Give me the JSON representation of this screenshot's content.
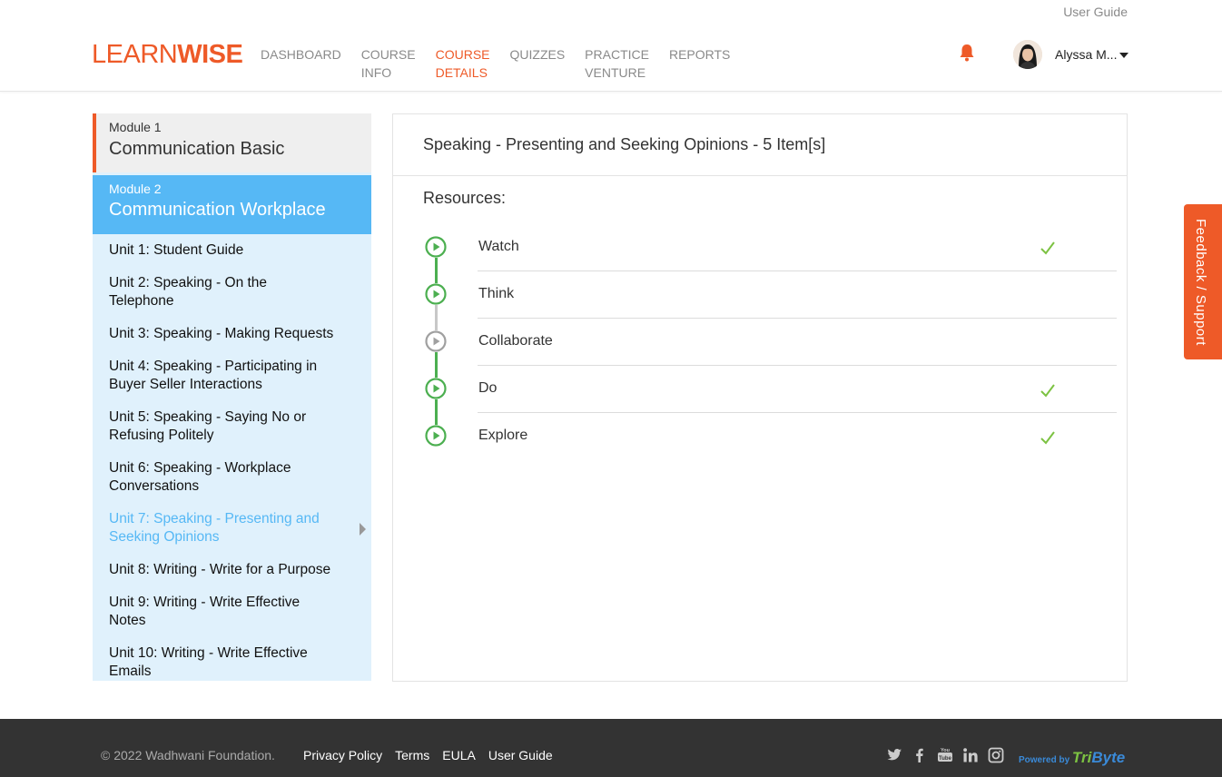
{
  "header": {
    "top_link": "User Guide",
    "logo_learn": "LEARN",
    "logo_wise": "WISE",
    "nav": [
      {
        "line1": "DASHBOARD",
        "line2": ""
      },
      {
        "line1": "COURSE",
        "line2": "INFO"
      },
      {
        "line1": "COURSE",
        "line2": "DETAILS"
      },
      {
        "line1": "QUIZZES",
        "line2": ""
      },
      {
        "line1": "PRACTICE",
        "line2": "VENTURE"
      },
      {
        "line1": "REPORTS",
        "line2": ""
      }
    ],
    "active_nav": "COURSE DETAILS",
    "user_name": "Alyssa M..."
  },
  "sidebar": {
    "module1": {
      "label": "Module 1",
      "title": "Communication Basic"
    },
    "module2": {
      "label": "Module 2",
      "title": "Communication Workplace"
    },
    "units": [
      {
        "line1": "Unit 1: Student Guide",
        "line2": ""
      },
      {
        "line1": "Unit 2: Speaking - On the",
        "line2": "Telephone"
      },
      {
        "line1": "Unit 3: Speaking - Making Requests",
        "line2": ""
      },
      {
        "line1": "Unit 4: Speaking - Participating in",
        "line2": "Buyer Seller Interactions"
      },
      {
        "line1": "Unit 5: Speaking - Saying No or",
        "line2": "Refusing Politely"
      },
      {
        "line1": "Unit 6: Speaking - Workplace",
        "line2": "Conversations"
      },
      {
        "line1": "Unit 7: Speaking - Presenting and",
        "line2": "Seeking Opinions"
      },
      {
        "line1": "Unit 8: Writing - Write for a Purpose",
        "line2": ""
      },
      {
        "line1": "Unit 9: Writing - Write Effective",
        "line2": "Notes"
      },
      {
        "line1": "Unit 10: Writing - Write Effective",
        "line2": "Emails"
      }
    ],
    "active_unit": "Unit 7: Speaking - Presenting and Seeking Opinions"
  },
  "main": {
    "title": "Speaking - Presenting and Seeking Opinions - 5 Item[s]",
    "resources_label": "Resources:",
    "resources": [
      {
        "label": "Watch",
        "completed": true,
        "icon": "play-circle-icon",
        "status_color": "#4caf50"
      },
      {
        "label": "Think",
        "completed": false,
        "icon": "play-circle-icon",
        "status_color": "#4caf50"
      },
      {
        "label": "Collaborate",
        "completed": false,
        "icon": "play-circle-icon",
        "status_color": "#a0a0a0"
      },
      {
        "label": "Do",
        "completed": true,
        "icon": "play-circle-icon",
        "status_color": "#4caf50"
      },
      {
        "label": "Explore",
        "completed": true,
        "icon": "play-circle-icon",
        "status_color": "#4caf50"
      }
    ]
  },
  "feedback_tab": "Feedback / Support",
  "footer": {
    "copyright": "© 2022 Wadhwani Foundation.",
    "links": [
      "Privacy Policy",
      "Terms",
      "EULA",
      "User Guide"
    ],
    "social_icons": [
      "twitter-icon",
      "facebook-icon",
      "youtube-icon",
      "linkedin-icon",
      "instagram-icon"
    ],
    "powered_by": "Powered by",
    "brand_part1": "Tri",
    "brand_part2": "Byte"
  },
  "colors": {
    "accent": "#ee5a28",
    "module_active": "#56b8f5",
    "sidebar_bg": "#e0f1fc",
    "complete_green": "#4caf50",
    "check_green": "#7cc242"
  }
}
